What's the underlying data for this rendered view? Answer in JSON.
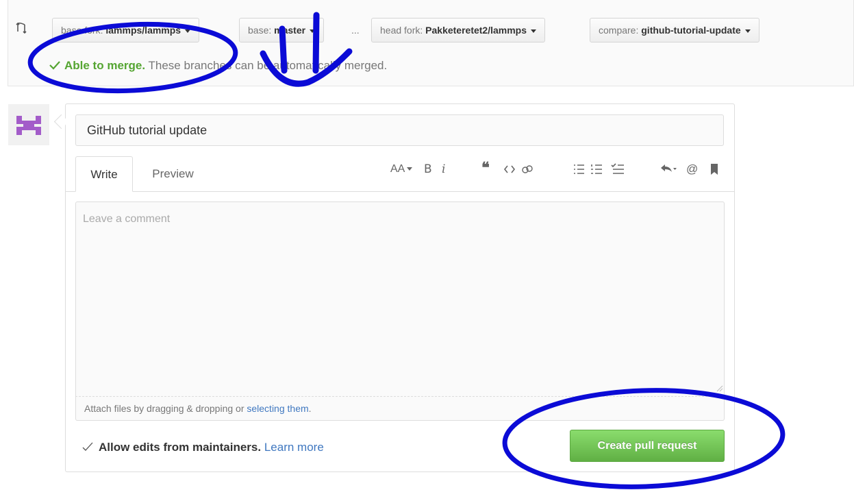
{
  "range_editor": {
    "base_fork_prefix": "base fork:",
    "base_fork_value": "lammps/lammps",
    "base_prefix": "base:",
    "base_value": "master",
    "separator": "...",
    "head_fork_prefix": "head fork:",
    "head_fork_value": "Pakketeretet2/lammps",
    "compare_prefix": "compare:",
    "compare_value": "github-tutorial-update"
  },
  "merge_status": {
    "label": "Able to merge.",
    "description": "These branches can be automatically merged."
  },
  "pull_request_form": {
    "title_value": "GitHub tutorial update",
    "tabs": [
      {
        "label": "Write",
        "active": true
      },
      {
        "label": "Preview",
        "active": false
      }
    ],
    "comment_placeholder": "Leave a comment",
    "attach_text": "Attach files by dragging & dropping or ",
    "attach_link": "selecting them",
    "attach_suffix": ".",
    "maintainers_label": "Allow edits from maintainers.",
    "learn_more": "Learn more",
    "submit_label": "Create pull request"
  },
  "toolbar": {
    "header": "AA",
    "bold": "B",
    "italic": "i",
    "quote": "❝",
    "mention": "@"
  },
  "colors": {
    "success_green": "#55a532",
    "button_green": "#60b044",
    "link_blue": "#4078c0",
    "annotation_blue": "#0b0bd6",
    "avatar_purple": "#a35cc9"
  }
}
